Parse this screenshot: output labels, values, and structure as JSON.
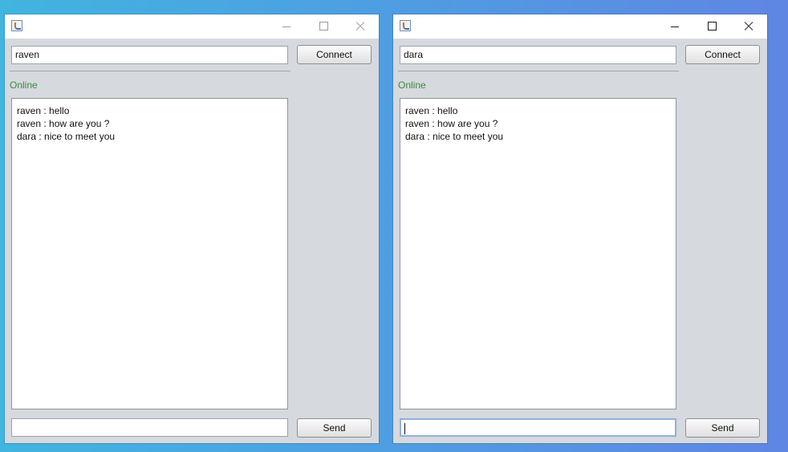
{
  "windows": [
    {
      "username": "raven",
      "connect_label": "Connect",
      "status": "Online",
      "status_color": "#3a8b3a",
      "messages": [
        "raven : hello",
        "raven : how are you ?",
        "dara : nice to meet you"
      ],
      "message_input": "",
      "send_label": "Send"
    },
    {
      "username": "dara",
      "connect_label": "Connect",
      "status": "Online",
      "status_color": "#3a8b3a",
      "messages": [
        "raven : hello",
        "raven : how are you ?",
        "dara : nice to meet you"
      ],
      "message_input": "",
      "send_label": "Send"
    }
  ]
}
